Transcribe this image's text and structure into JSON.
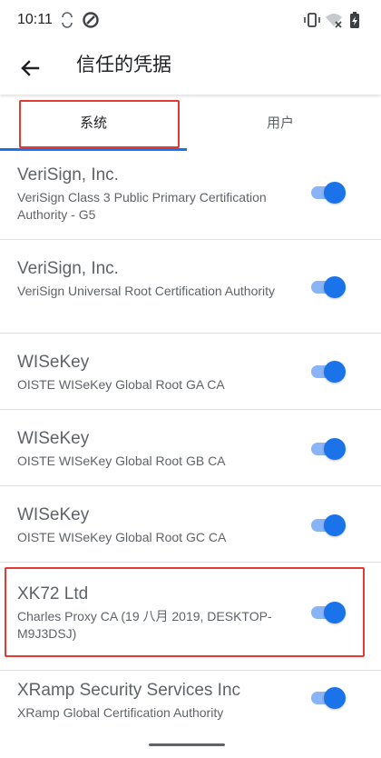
{
  "status_bar": {
    "time": "10:11"
  },
  "app_bar": {
    "title": "信任的凭据"
  },
  "tabs": [
    {
      "label": "系统",
      "selected": true
    },
    {
      "label": "用户",
      "selected": false
    }
  ],
  "certificates": [
    {
      "issuer": "VeriSign, Inc.",
      "name": "VeriSign Class 3 Public Primary Certification Authority - G5",
      "enabled": true
    },
    {
      "issuer": "VeriSign, Inc.",
      "name": "VeriSign Universal Root Certification Authority",
      "enabled": true
    },
    {
      "issuer": "WISeKey",
      "name": "OISTE WISeKey Global Root GA CA",
      "enabled": true
    },
    {
      "issuer": "WISeKey",
      "name": "OISTE WISeKey Global Root GB CA",
      "enabled": true
    },
    {
      "issuer": "WISeKey",
      "name": "OISTE WISeKey Global Root GC CA",
      "enabled": true
    },
    {
      "issuer": "XK72 Ltd",
      "name": "Charles Proxy CA (19 八月 2019, DESKTOP-M9J3DSJ)",
      "enabled": true
    },
    {
      "issuer": "XRamp Security Services Inc",
      "name": "XRamp Global Certification Authority",
      "enabled": true
    }
  ],
  "colors": {
    "accent": "#1a73e8",
    "accent_light": "#8ab4f8",
    "highlight": "#e53935",
    "text_secondary": "#5f6368"
  }
}
